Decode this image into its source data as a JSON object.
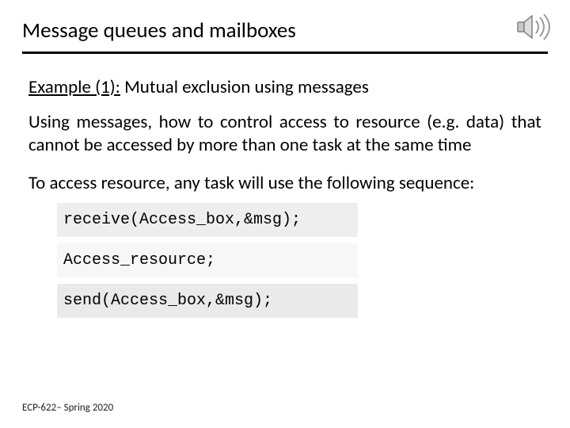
{
  "slide": {
    "title": "Message queues and mailboxes",
    "example_label": "Example (1):",
    "example_text": "  Mutual exclusion using messages",
    "paragraph1": "Using messages, how to control access to resource (e.g. data) that cannot be accessed by more than one task at the same time",
    "paragraph2": "To access resource, any task will use the following sequence:",
    "code": {
      "line1": "receive(Access_box,&msg);",
      "line2": "Access_resource;",
      "line3": "send(Access_box,&msg);"
    },
    "footer": "ECP-622– Spring 2020"
  }
}
